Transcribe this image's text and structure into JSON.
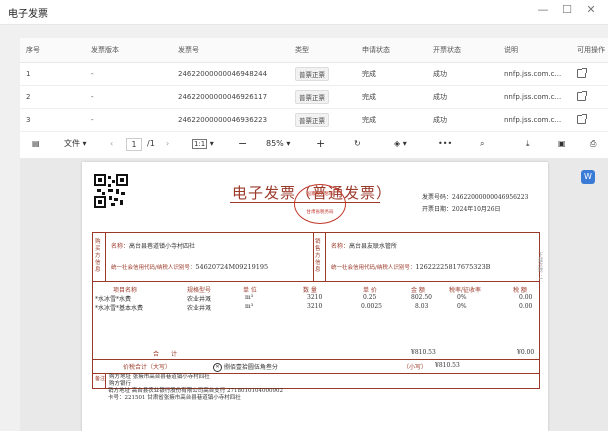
{
  "window": {
    "title": "电子发票"
  },
  "table": {
    "headers": [
      "序号",
      "发票版本",
      "发票号",
      "类型",
      "申请状态",
      "开票状态",
      "说明",
      "可用操作"
    ],
    "rows": [
      {
        "no": "1",
        "version": "-",
        "number": "24622000000046948244",
        "type": "普票正票",
        "apply": "完成",
        "issue": "成功",
        "note": "nnfp.jss.com.c..."
      },
      {
        "no": "2",
        "version": "-",
        "number": "24622000000046926117",
        "type": "普票正票",
        "apply": "完成",
        "issue": "成功",
        "note": "nnfp.jss.com.c..."
      },
      {
        "no": "3",
        "version": "-",
        "number": "24622000000046936223",
        "type": "普票正票",
        "apply": "完成",
        "issue": "成功",
        "note": "nnfp.jss.com.c..."
      }
    ]
  },
  "toolbar": {
    "file_label": "文件",
    "page_current": "1",
    "page_total": "/1",
    "fit_label": "1:1",
    "zoom": "85%"
  },
  "invoice": {
    "title": "电子发票（普通发票）",
    "stamp_top": "国家税务总局",
    "stamp_bottom": "甘肃省税务局",
    "no_label": "发票号码：",
    "no_value": "24622000000046956223",
    "date_label": "开票日期：",
    "date_value": "2024年10月26日",
    "buyer_label": "购买方信息",
    "seller_label": "销售方信息",
    "buyer_name_label": "名称：",
    "buyer_name": "高台县巷道镇小寺村四社",
    "seller_name_label": "名称：",
    "seller_name": "高台县友联水管所",
    "buyer_tax_label": "统一社会信用代码/纳税人识别号：",
    "buyer_tax": "54620724M09219195",
    "seller_tax_label": "统一社会信用代码/纳税人识别号：",
    "seller_tax": "12622225817675323B",
    "cols": [
      "项目名称",
      "规格型号",
      "单 位",
      "数 量",
      "单 价",
      "金 额",
      "税率/征收率",
      "税 额"
    ],
    "items": [
      {
        "name": "*水冰雪*水费",
        "spec": "农业井溉",
        "unit": "m³",
        "qty": "3210",
        "price": "0.25",
        "amount": "802.50",
        "rate": "0%",
        "tax": "0.00"
      },
      {
        "name": "*水冰雪*基本水费",
        "spec": "农业井溉",
        "unit": "m³",
        "qty": "3210",
        "price": "0.0025",
        "amount": "8.03",
        "rate": "0%",
        "tax": "0.00"
      }
    ],
    "total_label": "合　　计",
    "total_amount": "¥810.53",
    "total_tax": "¥0.00",
    "sum_label": "价税合计（大写）",
    "sum_words": "捌佰壹拾圆伍角叁分",
    "small_label": "（小写）",
    "small_value": "¥810.53",
    "remarks": [
      "购方地址 张掖市高台县巷道镇小寺村四社",
      "购方银行",
      "销方地址 高台县农业银行股份有限公司高台支行 2718010104000902",
      "卡号：221501 甘肃省张掖市高台县巷道镇小寺村四社"
    ],
    "side_text": "下载次数：1"
  }
}
